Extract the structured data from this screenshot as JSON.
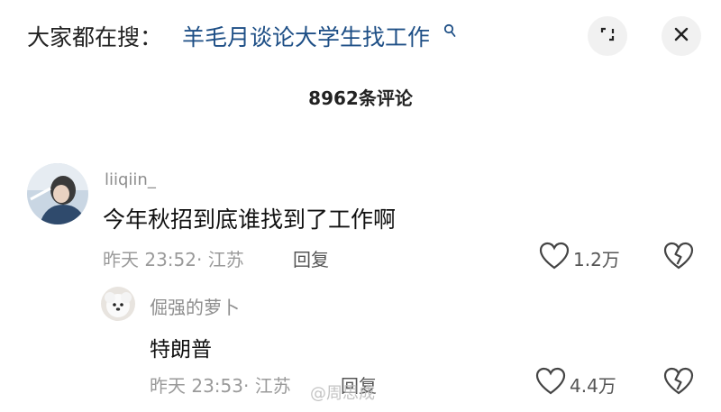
{
  "search_bar": {
    "prefix": "大家都在搜：",
    "query": "羊毛月谈论大学生找工作"
  },
  "comment_count": "8962条评论",
  "comments": [
    {
      "username": "liiqiin_",
      "text": "今年秋招到底谁找到了工作啊",
      "meta": "昨天 23:52· 江苏",
      "reply_label": "回复",
      "likes": "1.2万"
    }
  ],
  "replies": [
    {
      "username": "倔强的萝卜",
      "text": "特朗普",
      "meta": "昨天 23:53· 江苏",
      "reply_label": "回复",
      "likes": "4.4万"
    }
  ],
  "watermark": "@周思成",
  "icons": {
    "search": "search-icon",
    "expand": "expand-icon",
    "close": "close-icon",
    "like": "heart-icon",
    "dislike": "broken-heart-icon"
  },
  "colors": {
    "query": "#1e4f86",
    "muted": "#9a9a9a"
  }
}
